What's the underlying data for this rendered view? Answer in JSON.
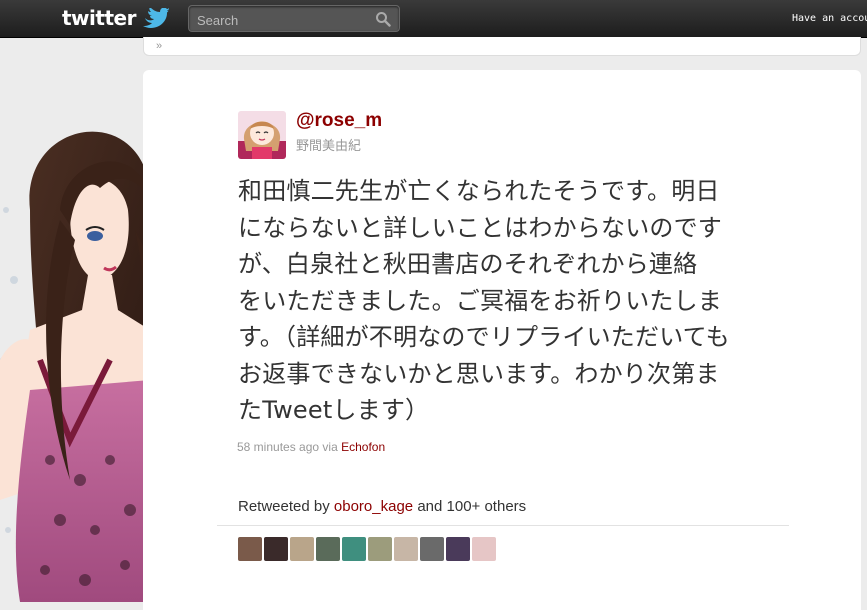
{
  "topbar": {
    "logo": "twitter",
    "search_placeholder": "Search",
    "account_text": "Have an accou"
  },
  "tweet": {
    "username": "@rose_m",
    "real_name": "野間美由紀",
    "lines": [
      "和田慎二先生が亡くなられたそうです。明日",
      "にならないと詳しいことはわからないのです",
      "が、白泉社と秋田書店のそれぞれから連絡",
      "をいただきました。ご冥福をお祈りいたしま",
      "す。（詳細が不明なのでリプライいただいても",
      "お返事できないかと思います。わかり次第ま",
      "たTweetします）"
    ],
    "time": "58 minutes ago",
    "via_prefix": "via",
    "via_app": "Echofon"
  },
  "retweets": {
    "prefix": "Retweeted by",
    "user": "oboro_kage",
    "suffix": "and 100+ others",
    "avatar_colors": [
      "#7a5a4a",
      "#3a2a2a",
      "#b9a58a",
      "#5a6b5a",
      "#3f8f7f",
      "#9c9c7c",
      "#c7b6a6",
      "#6a6a6a",
      "#4a3a5a",
      "#e6c6c6"
    ]
  },
  "colors": {
    "link": "#8c0000",
    "topbar": "#222222",
    "panel": "#ffffff"
  }
}
